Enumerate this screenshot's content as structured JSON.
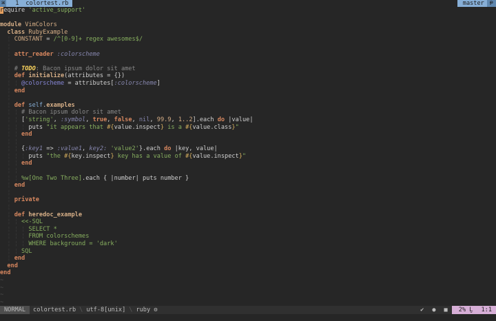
{
  "tabline": {
    "icon": "⌘",
    "tab_number": "1",
    "tab_name": "colortest.rb",
    "branch": "master",
    "branch_icon": "Ᵽ"
  },
  "code_lines": [
    [
      [
        "cursor",
        "r"
      ],
      [
        "plain",
        "equire "
      ],
      [
        "str",
        "'active_support'"
      ]
    ],
    [],
    [
      [
        "mod",
        "module "
      ],
      [
        "const",
        "VimColors"
      ]
    ],
    [
      [
        "plain",
        "  "
      ],
      [
        "mod",
        "class "
      ],
      [
        "const",
        "RubyExample"
      ]
    ],
    [
      [
        "ig",
        "  ¦ "
      ],
      [
        "const",
        "CONSTANT"
      ],
      [
        "plain",
        " = "
      ],
      [
        "str",
        "/^[0-9]+ regex awesomes$/"
      ]
    ],
    [
      [
        "ig",
        "  ¦"
      ]
    ],
    [
      [
        "ig",
        "  ¦ "
      ],
      [
        "kw",
        "attr_reader "
      ],
      [
        "sym",
        ":colorscheme"
      ]
    ],
    [
      [
        "ig",
        "  ¦"
      ]
    ],
    [
      [
        "ig",
        "  ¦ "
      ],
      [
        "com",
        "# "
      ],
      [
        "todo",
        "TODO"
      ],
      [
        "com",
        ": Bacon ipsum dolor sit amet"
      ]
    ],
    [
      [
        "ig",
        "  ¦ "
      ],
      [
        "kw",
        "def "
      ],
      [
        "fn",
        "initialize"
      ],
      [
        "plain",
        "(attributes = {})"
      ]
    ],
    [
      [
        "ig",
        "  ¦ ¦ "
      ],
      [
        "ivar",
        "@colorscheme"
      ],
      [
        "plain",
        " = attributes["
      ],
      [
        "sym",
        ":colorscheme"
      ],
      [
        "plain",
        "]"
      ]
    ],
    [
      [
        "ig",
        "  ¦ "
      ],
      [
        "kw",
        "end"
      ]
    ],
    [
      [
        "ig",
        "  ¦"
      ]
    ],
    [
      [
        "ig",
        "  ¦ "
      ],
      [
        "kw",
        "def "
      ],
      [
        "self",
        "self"
      ],
      [
        "plain",
        "."
      ],
      [
        "fn",
        "examples"
      ]
    ],
    [
      [
        "ig",
        "  ¦ ¦ "
      ],
      [
        "com",
        "# Bacon ipsum dolor sit amet"
      ]
    ],
    [
      [
        "ig",
        "  ¦ ¦ "
      ],
      [
        "plain",
        "["
      ],
      [
        "str",
        "'string'"
      ],
      [
        "plain",
        ", "
      ],
      [
        "sym",
        ":symbol"
      ],
      [
        "plain",
        ", "
      ],
      [
        "bool",
        "true"
      ],
      [
        "plain",
        ", "
      ],
      [
        "bool",
        "false"
      ],
      [
        "plain",
        ", "
      ],
      [
        "nil",
        "nil"
      ],
      [
        "plain",
        ", "
      ],
      [
        "num",
        "99.9"
      ],
      [
        "plain",
        ", "
      ],
      [
        "num",
        "1..2"
      ],
      [
        "plain",
        "].each "
      ],
      [
        "kw",
        "do"
      ],
      [
        "plain",
        " |value|"
      ]
    ],
    [
      [
        "ig",
        "  ¦ ¦ ¦ "
      ],
      [
        "plain",
        "puts "
      ],
      [
        "str",
        "\"it appears that "
      ],
      [
        "interp",
        "#{"
      ],
      [
        "plain",
        "value.inspect"
      ],
      [
        "interp",
        "}"
      ],
      [
        "str",
        " is a "
      ],
      [
        "interp",
        "#{"
      ],
      [
        "plain",
        "value.class"
      ],
      [
        "interp",
        "}"
      ],
      [
        "str",
        "\""
      ]
    ],
    [
      [
        "ig",
        "  ¦ ¦ "
      ],
      [
        "kw",
        "end"
      ]
    ],
    [
      [
        "ig",
        "  ¦ ¦"
      ]
    ],
    [
      [
        "ig",
        "  ¦ ¦ "
      ],
      [
        "plain",
        "{"
      ],
      [
        "sym",
        ":key1"
      ],
      [
        "plain",
        " => "
      ],
      [
        "sym",
        ":value1"
      ],
      [
        "plain",
        ", "
      ],
      [
        "sym",
        "key2:"
      ],
      [
        "plain",
        " "
      ],
      [
        "str",
        "'value2'"
      ],
      [
        "plain",
        "}.each "
      ],
      [
        "kw",
        "do"
      ],
      [
        "plain",
        " |key, value|"
      ]
    ],
    [
      [
        "ig",
        "  ¦ ¦ ¦ "
      ],
      [
        "plain",
        "puts "
      ],
      [
        "str",
        "\"the "
      ],
      [
        "interp",
        "#{"
      ],
      [
        "plain",
        "key.inspect"
      ],
      [
        "interp",
        "}"
      ],
      [
        "str",
        " key has a value of "
      ],
      [
        "interp",
        "#{"
      ],
      [
        "plain",
        "value.inspect"
      ],
      [
        "interp",
        "}"
      ],
      [
        "str",
        "\""
      ]
    ],
    [
      [
        "ig",
        "  ¦ ¦ "
      ],
      [
        "kw",
        "end"
      ]
    ],
    [
      [
        "ig",
        "  ¦ ¦"
      ]
    ],
    [
      [
        "ig",
        "  ¦ ¦ "
      ],
      [
        "str",
        "%w[One Two Three]"
      ],
      [
        "plain",
        ".each { |number| puts number }"
      ]
    ],
    [
      [
        "ig",
        "  ¦ "
      ],
      [
        "kw",
        "end"
      ]
    ],
    [
      [
        "ig",
        "  ¦"
      ]
    ],
    [
      [
        "ig",
        "  ¦ "
      ],
      [
        "kw",
        "private"
      ]
    ],
    [
      [
        "ig",
        "  ¦"
      ]
    ],
    [
      [
        "ig",
        "  ¦ "
      ],
      [
        "kw",
        "def "
      ],
      [
        "fn",
        "heredoc_example"
      ]
    ],
    [
      [
        "ig",
        "  ¦ ¦ "
      ],
      [
        "str",
        "<<-SQL"
      ]
    ],
    [
      [
        "ig",
        "  ¦ ¦ ¦ "
      ],
      [
        "str",
        "SELECT *"
      ]
    ],
    [
      [
        "ig",
        "  ¦ ¦ ¦ "
      ],
      [
        "str",
        "FROM colorschemes"
      ]
    ],
    [
      [
        "ig",
        "  ¦ ¦ ¦ "
      ],
      [
        "str",
        "WHERE background = 'dark'"
      ]
    ],
    [
      [
        "ig",
        "  ¦ ¦ "
      ],
      [
        "str",
        "SQL"
      ]
    ],
    [
      [
        "ig",
        "  ¦ "
      ],
      [
        "kw",
        "end"
      ]
    ],
    [
      [
        "plain",
        "  "
      ],
      [
        "kw",
        "end"
      ]
    ],
    [
      [
        "kw",
        "end"
      ]
    ],
    [
      [
        "tilde",
        "~"
      ]
    ],
    [
      [
        "tilde",
        "~"
      ]
    ],
    [
      [
        "tilde",
        "~"
      ]
    ],
    [
      [
        "tilde",
        "~"
      ]
    ]
  ],
  "statusline": {
    "mode": "NORMAL",
    "filename": "colortest.rb",
    "encoding": "utf-8[unix]",
    "filetype": "ruby",
    "filetype_icon": "⚙",
    "check_icon": "✔",
    "dot_icon": "●",
    "square_icon": "■",
    "percent": "2%",
    "line_icon": "Ḻ",
    "position": "1:1"
  },
  "colors": {
    "background": "#262626",
    "tab_active": "#87afd7",
    "position_bg": "#d7afd7",
    "keyword": "#d7875f",
    "string": "#87af5f",
    "symbol": "#8787af"
  }
}
